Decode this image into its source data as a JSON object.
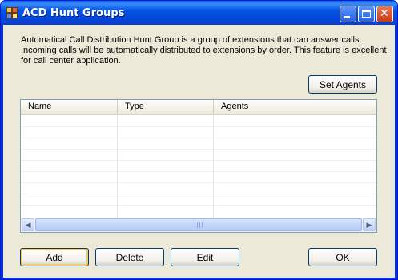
{
  "window": {
    "title": "ACD Hunt Groups",
    "icon": "app-window-icon"
  },
  "caption_buttons": {
    "minimize": "minimize-icon",
    "maximize": "maximize-icon",
    "close": "close-icon",
    "close_glyph": "✕"
  },
  "description": {
    "line1": "Automatical Call Distribution Hunt Group is a group of extensions that can answer calls.",
    "line2": "Incoming calls will be automatically distributed to extensions by order.  This feature is excellent",
    "line3": "for call center application."
  },
  "set_agents_label": "Set Agents",
  "list": {
    "columns": [
      "Name",
      "Type",
      "Agents"
    ],
    "rows": []
  },
  "scrollbar": {
    "left_glyph": "◀",
    "right_glyph": "▶"
  },
  "buttons": {
    "add": "Add",
    "delete": "Delete",
    "edit": "Edit",
    "ok": "OK"
  },
  "colors": {
    "titlebar": "#0454e6",
    "client": "#ece9d8",
    "list_border": "#7f9db9"
  }
}
